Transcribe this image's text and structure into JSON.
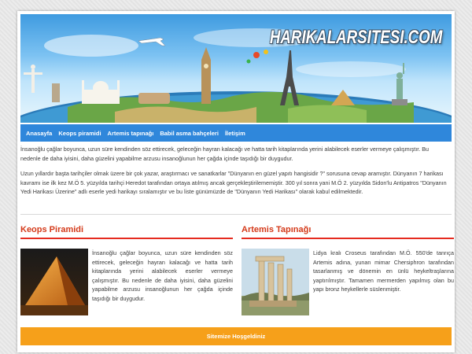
{
  "site": {
    "logo_text": "HARIKALARSITESI.COM"
  },
  "nav": {
    "items": [
      "Anasayfa",
      "Keops piramidi",
      "Artemis tapınağı",
      "Babil asma bahçeleri",
      "İletişim"
    ]
  },
  "intro": {
    "paragraphs": [
      "İnsanoğlu çağlar boyunca, uzun süre kendinden söz ettirecek, geleceğin hayran kalacağı ve hatta tarih kitaplarında yerini alabilecek eserler vermeye çalışmıştır. Bu nedenle de daha iyisini, daha güzelini yapabilme arzusu insanoğlunun her çağda içinde taşıdığı bir duygudur.",
      "Uzun yıllardır başta tarihçiler olmak üzere bir çok yazar, araştırmacı ve sanatkarlar \"Dünyanın en güzel yapıtı hangisidir ?\" sorusuna cevap aramıştır. Dünyanın 7 harikası kavramı ise ilk kez M.Ö 5. yüzyılda tarihçi Heredot tarafından ortaya atılmış ancak gerçekleştirilememiştir. 300 yıl sonra yani M.Ö 2. yüzyılda Sidon'lu Antipatros \"Dünyanın Yedi Harikası Üzerine\" adlı eserle yedi harikayı sıralamıştır ve bu liste günümüzde de \"Dünyanın Yedi Harikası\" olarak kabul edilmektedir."
    ]
  },
  "sections": {
    "keops": {
      "title": "Keops Piramidi",
      "text": "İnsanoğlu çağlar boyunca, uzun süre kendinden söz ettirecek, geleceğin hayran kalacağı ve hatta tarih kitaplarında yerini alabilecek eserler vermeye çalışmıştır. Bu nedenle de daha iyisini, daha güzelini yapabilme arzusu insanoğlunun her çağda içinde taşıdığı bir duygudur."
    },
    "artemis": {
      "title": "Artemis Tapınağı",
      "text": "Lidya kralı Croseus tarafından M.Ö. 550'de tanrıça Artemis adına, yunan mimar Chersiphron tarafından tasarlanmış ve dönemin en ünlü heykeltraşlarına yaptırılmıştır. Tamamen mermerden yapılmış olan bu yapı bronz heykellerle süslenmiştir."
    }
  },
  "footer": {
    "text": "Sitemize Hoşgeldiniz"
  },
  "colors": {
    "nav_bg": "#2f87db",
    "section_title": "#d43a1a",
    "section_rule": "#e52b1f",
    "footer_bg": "#f6a01a"
  },
  "icons": {
    "header_banner": "world-wonders-banner",
    "keops_image": "pyramid-image",
    "artemis_image": "temple-ruins-image"
  }
}
